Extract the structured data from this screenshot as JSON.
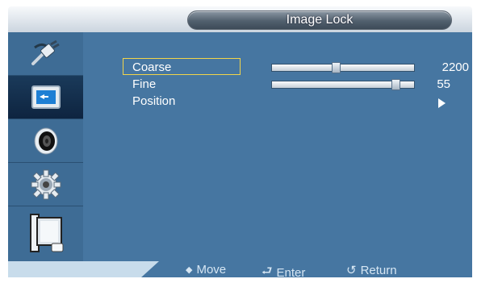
{
  "window": {
    "title": "Image Lock"
  },
  "sidebar": {
    "items": [
      {
        "icon": "input-plug-icon",
        "selected": false
      },
      {
        "icon": "picture-icon",
        "selected": true
      },
      {
        "icon": "sound-icon",
        "selected": false
      },
      {
        "icon": "setup-gear-icon",
        "selected": false
      },
      {
        "icon": "multi-control-icon",
        "selected": false
      }
    ]
  },
  "menu": {
    "coarse": {
      "label": "Coarse",
      "value": "2200",
      "level": 0.45
    },
    "fine": {
      "label": "Fine",
      "value": "55",
      "level": 0.87
    },
    "position": {
      "label": "Position",
      "arrow": "▶"
    }
  },
  "footer": {
    "move_icon": "◆",
    "move_label": "Move",
    "enter_icon": "⮐",
    "enter_label": "Enter",
    "return_icon": "↺",
    "return_label": "Return"
  },
  "colors": {
    "panel": "#4676a1",
    "sidebar": "#3e6c95",
    "selection": "#f2d54a"
  }
}
